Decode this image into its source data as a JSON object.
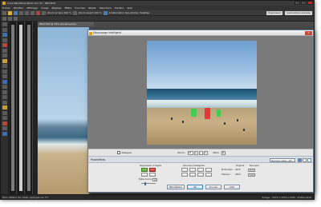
{
  "app": {
    "title": "Corel PaintShop Photo Pro X3 - IMG7503",
    "menu": [
      "Fichier",
      "Modifier",
      "Affichage",
      "Image",
      "Réglage",
      "Effets",
      "Couches",
      "Objets",
      "Sélections",
      "Fenêtre",
      "Aide"
    ],
    "toolbar": {
      "zoom_out_label": "Zoom arrière 100 %",
      "zoom_in_label": "Zoom avant 100 %",
      "adjust_label": "Amélioration des photos",
      "palettes_label": "Palettes",
      "organizer_label": "Organiseur",
      "workspace_label": "Laboratoire express"
    },
    "document_tab": "IMG7503 @ 33% (Arrière-plan)",
    "status_left": "Pour obtenir de l'aide, appuyez sur F1",
    "status_right": "Image : 3072 x 2304 x RVB - 8 bits/canal"
  },
  "dialog": {
    "title": "Découpage intelligent",
    "close_label": "✕",
    "preview": {
      "masquer_label": "Masquer",
      "zoom_label": "Zoom :",
      "zoom_value": "18",
      "main_label": "Main :"
    },
    "params": {
      "section_label": "Paramètres",
      "preset_label": "Dernière valeur utili..."
    },
    "panel": {
      "suppression_label": "Suppression d'objets",
      "brush_size_label": "Taille du pinceau :",
      "brush_size_value": "10",
      "smart_carving_label": "Découpe intelligente",
      "original_label": "Original",
      "new_label": "Nouveau",
      "width_label": "Profondeur :",
      "width_original": "3072",
      "width_new": "3072",
      "height_label": "Hauteur :",
      "height_original": "2304",
      "height_new": "2304"
    },
    "buttons": {
      "reset_label": "Réinitialiser",
      "ok_label": "OK",
      "cancel_label": "Annuler",
      "help_label": "Aide"
    }
  },
  "colors": {
    "mask_keep": "#2fd24a",
    "mask_remove": "#e6262a",
    "accent": "#4a7ab8"
  }
}
